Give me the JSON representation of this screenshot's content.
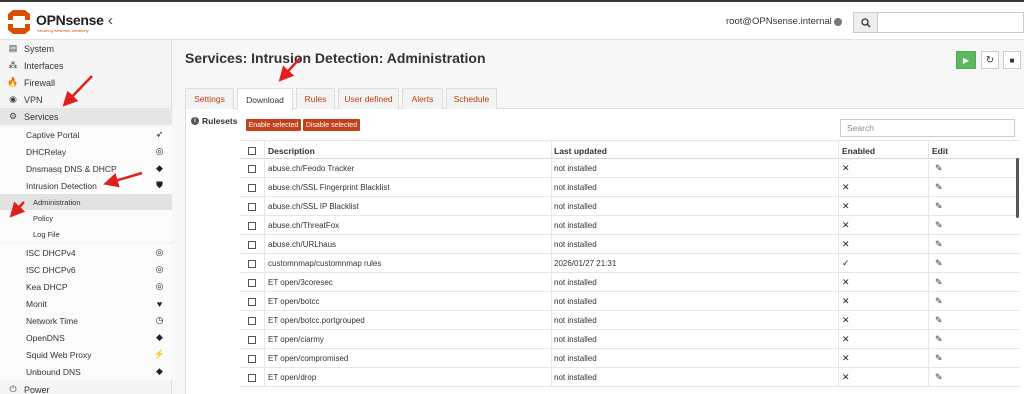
{
  "header": {
    "logo_text": "OPNsense",
    "logo_tagline": "Securing networks, intuitively",
    "user": "root@OPNsense.internal",
    "status_icon": "status-dot",
    "search_icon": "search-icon",
    "collapse_icon": "chevron-left-icon"
  },
  "sidebar": {
    "items": [
      {
        "label": "System",
        "icon": "server-icon",
        "glyph": "▤"
      },
      {
        "label": "Interfaces",
        "icon": "sitemap-icon",
        "glyph": "⁂"
      },
      {
        "label": "Firewall",
        "icon": "fire-icon",
        "glyph": "🔥"
      },
      {
        "label": "VPN",
        "icon": "globe-icon",
        "glyph": "◉"
      },
      {
        "label": "Services",
        "icon": "gear-icon",
        "glyph": "⚙"
      }
    ],
    "services": [
      {
        "label": "Captive Portal",
        "icon": "send-icon",
        "glyph": "➶"
      },
      {
        "label": "DHCRelay",
        "icon": "bullseye-icon",
        "glyph": "◎"
      },
      {
        "label": "Dnsmasq DNS & DHCP",
        "icon": "tags-icon",
        "glyph": "◆"
      },
      {
        "label": "Intrusion Detection",
        "icon": "shield-icon",
        "glyph": "⛊"
      }
    ],
    "ids_sub": [
      {
        "label": "Administration"
      },
      {
        "label": "Policy"
      },
      {
        "label": "Log File"
      }
    ],
    "services_after": [
      {
        "label": "ISC DHCPv4",
        "icon": "bullseye-icon",
        "glyph": "◎"
      },
      {
        "label": "ISC DHCPv6",
        "icon": "bullseye-icon",
        "glyph": "◎"
      },
      {
        "label": "Kea DHCP",
        "icon": "bullseye-icon",
        "glyph": "◎"
      },
      {
        "label": "Monit",
        "icon": "heartbeat-icon",
        "glyph": "♥"
      },
      {
        "label": "Network Time",
        "icon": "clock-icon",
        "glyph": "◷"
      },
      {
        "label": "OpenDNS",
        "icon": "tags-icon",
        "glyph": "◆"
      },
      {
        "label": "Squid Web Proxy",
        "icon": "bolt-icon",
        "glyph": "⚡"
      },
      {
        "label": "Unbound DNS",
        "icon": "tags-icon",
        "glyph": "◆"
      }
    ],
    "power": {
      "label": "Power",
      "icon": "plug-icon",
      "glyph": "⏻"
    }
  },
  "main": {
    "title": "Services: Intrusion Detection: Administration",
    "tabs": [
      "Settings",
      "Download",
      "Rules",
      "User defined",
      "Alerts",
      "Schedule"
    ],
    "active_tab": "Download",
    "section_label": "Rulesets",
    "enable_selected": "Enable selected",
    "disable_selected": "Disable selected",
    "search_placeholder": "Search"
  },
  "table": {
    "columns": [
      "Description",
      "Last updated",
      "Enabled",
      "Edit"
    ],
    "rows": [
      {
        "description": "abuse.ch/Feodo Tracker",
        "last_updated": "not installed",
        "enabled": false
      },
      {
        "description": "abuse.ch/SSL Fingerprint Blacklist",
        "last_updated": "not installed",
        "enabled": false
      },
      {
        "description": "abuse.ch/SSL IP Blacklist",
        "last_updated": "not installed",
        "enabled": false
      },
      {
        "description": "abuse.ch/ThreatFox",
        "last_updated": "not installed",
        "enabled": false
      },
      {
        "description": "abuse.ch/URLhaus",
        "last_updated": "not installed",
        "enabled": false
      },
      {
        "description": "customnmap/customnmap rules",
        "last_updated": "2026/01/27 21:31",
        "enabled": true
      },
      {
        "description": "ET open/3coresec",
        "last_updated": "not installed",
        "enabled": false
      },
      {
        "description": "ET open/botcc",
        "last_updated": "not installed",
        "enabled": false
      },
      {
        "description": "ET open/botcc.portgrouped",
        "last_updated": "not installed",
        "enabled": false
      },
      {
        "description": "ET open/ciarmy",
        "last_updated": "not installed",
        "enabled": false
      },
      {
        "description": "ET open/compromised",
        "last_updated": "not installed",
        "enabled": false
      },
      {
        "description": "ET open/drop",
        "last_updated": "not installed",
        "enabled": false
      }
    ]
  },
  "colors": {
    "brand": "#d94f00",
    "tab_text": "#c03a0c",
    "button_red": "#c4401b",
    "button_green": "#5cb85c",
    "annotation_arrow": "#e02020"
  }
}
